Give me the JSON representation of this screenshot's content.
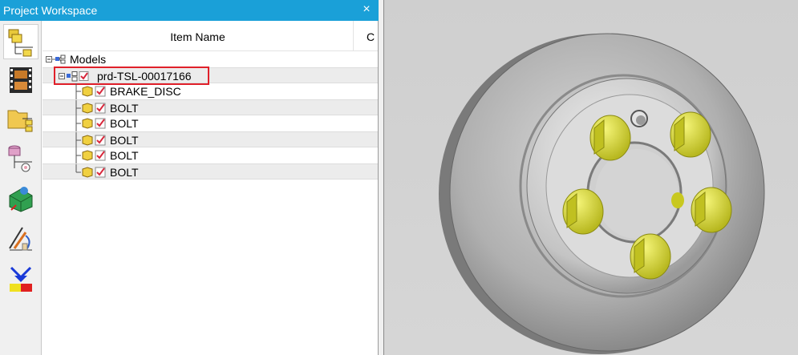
{
  "workspace": {
    "title": "Project Workspace",
    "close_glyph": "×"
  },
  "toolbar": {
    "tools": [
      {
        "name": "assembly-tree-icon",
        "active": true
      },
      {
        "name": "film-strip-icon",
        "active": false
      },
      {
        "name": "folder-tree-icon",
        "active": false
      },
      {
        "name": "database-tree-icon",
        "active": false
      },
      {
        "name": "3d-globe-icon",
        "active": false
      },
      {
        "name": "measure-tool-icon",
        "active": false
      },
      {
        "name": "section-tool-icon",
        "active": false
      }
    ]
  },
  "table": {
    "columns": [
      "Item Name",
      "C"
    ]
  },
  "tree": {
    "root_label": "Models",
    "product_label": "prd-TSL-00017166",
    "parts": [
      "BRAKE_DISC",
      "BOLT",
      "BOLT",
      "BOLT",
      "BOLT",
      "BOLT"
    ]
  },
  "viewport": {
    "model": "brake disc with bolts",
    "background_color": "#d2d2d2",
    "disc_color": "#b8b8b8",
    "bolt_color": "#e6e63a"
  },
  "colors": {
    "titlebar": "#1aa0d8",
    "highlight": "#e0202a",
    "check": "#d8283c"
  }
}
